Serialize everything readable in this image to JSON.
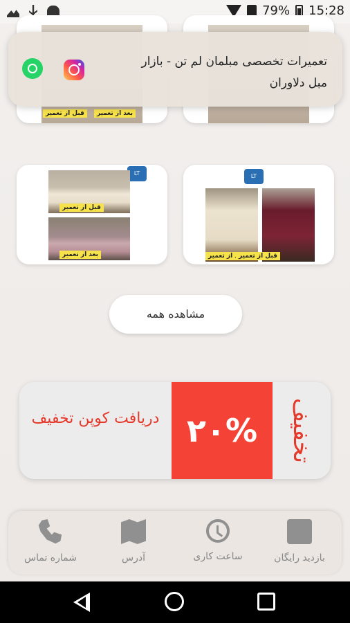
{
  "status_bar": {
    "battery_percent": "79%",
    "time": "15:28"
  },
  "banner": {
    "title": "تعمیرات تخصصی مبلمان لم تن - بازار مبل دلاوران"
  },
  "gallery": {
    "before_label": "قبل از تعمیر",
    "after_label": "بعد از تعمیر"
  },
  "see_all": {
    "label": "مشاهده همه"
  },
  "coupon": {
    "text": "دریافت کوپن تخفیف",
    "percent": "۲۰%",
    "vertical": "تخفیف"
  },
  "bottom_nav": {
    "items": [
      {
        "label": "شماره تماس",
        "icon": "phone-icon"
      },
      {
        "label": "آدرس",
        "icon": "map-icon"
      },
      {
        "label": "ساعت کاری",
        "icon": "clock-icon"
      },
      {
        "label": "بازدید رایگان",
        "icon": "calendar-icon"
      }
    ]
  },
  "colors": {
    "accent": "#f44336",
    "whatsapp": "#25D366",
    "icon_gray": "#909090"
  }
}
